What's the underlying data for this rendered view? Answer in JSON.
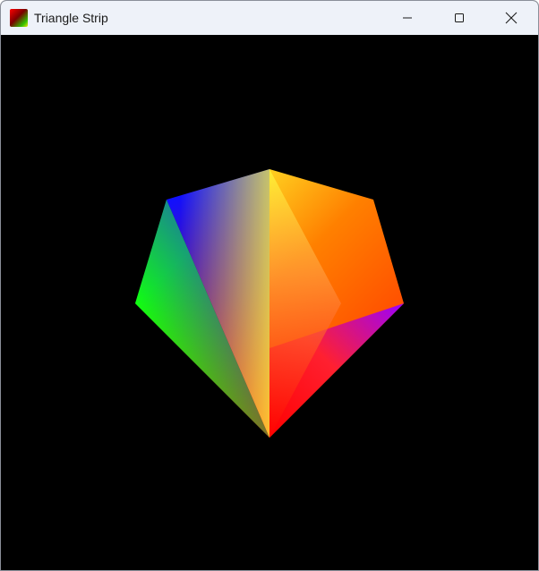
{
  "window": {
    "title": "Triangle Strip",
    "background": "#000000",
    "titlebar_color": "#eef2f9"
  },
  "controls": {
    "minimize": "minimize-icon",
    "maximize": "maximize-icon",
    "close": "close-icon"
  },
  "scene": {
    "shape": "pentagon rendered as triangle strip",
    "vertex_colors": {
      "top": "#ffff00",
      "upper_left": "#0000ff",
      "left": "#00ff00",
      "bottom": "#ff0000",
      "right": "#9900ff",
      "upper_right": "#ff8000"
    }
  }
}
